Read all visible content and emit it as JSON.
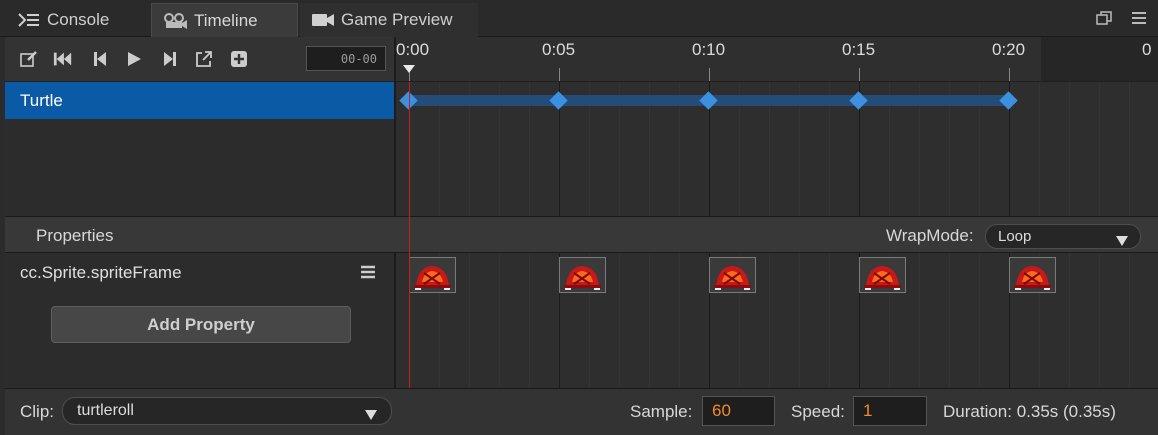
{
  "tabs": [
    {
      "label": "Console",
      "icon": "console-icon",
      "active": false
    },
    {
      "label": "Timeline",
      "icon": "timeline-icon",
      "active": true
    },
    {
      "label": "Game Preview",
      "icon": "camera-icon",
      "active": false
    }
  ],
  "window_controls": [
    {
      "icon": "popout-icon"
    },
    {
      "icon": "menu-icon"
    }
  ],
  "toolbar": {
    "buttons": [
      {
        "icon": "edit-icon"
      },
      {
        "icon": "jump-to-start-icon"
      },
      {
        "icon": "prev-frame-icon"
      },
      {
        "icon": "play-icon"
      },
      {
        "icon": "next-frame-icon"
      },
      {
        "icon": "add-event-icon"
      },
      {
        "icon": "add-keyframe-icon"
      }
    ],
    "frame_value": "00-00"
  },
  "ruler": {
    "ticks": [
      {
        "label": "0:00",
        "seconds": 0
      },
      {
        "label": "0:05",
        "seconds": 5
      },
      {
        "label": "0:10",
        "seconds": 10
      },
      {
        "label": "0:15",
        "seconds": 15
      },
      {
        "label": "0:20",
        "seconds": 20
      },
      {
        "label": "0",
        "seconds": 25
      }
    ],
    "playhead_seconds": 0
  },
  "nodes": [
    {
      "name": "Turtle",
      "selected": true,
      "keyframe_seconds": [
        0,
        5,
        10,
        15,
        20
      ]
    }
  ],
  "properties": {
    "header": "Properties",
    "wrapmode_label": "WrapMode:",
    "wrapmode_value": "Loop",
    "items": [
      {
        "name": "cc.Sprite.spriteFrame",
        "keyframe_seconds": [
          0,
          5,
          10,
          15,
          20
        ]
      }
    ],
    "add_button": "Add Property"
  },
  "footer": {
    "clip_label": "Clip:",
    "clip_value": "turtleroll",
    "sample_label": "Sample:",
    "sample_value": "60",
    "speed_label": "Speed:",
    "speed_value": "1",
    "duration_text": "Duration: 0.35s (0.35s)"
  },
  "colors": {
    "selected_row": "#0a5aa5",
    "keyframe": "#3d8fe0",
    "keyframe_bar": "#234d78",
    "playhead": "#c02020",
    "input_value": "#f08a2a"
  }
}
